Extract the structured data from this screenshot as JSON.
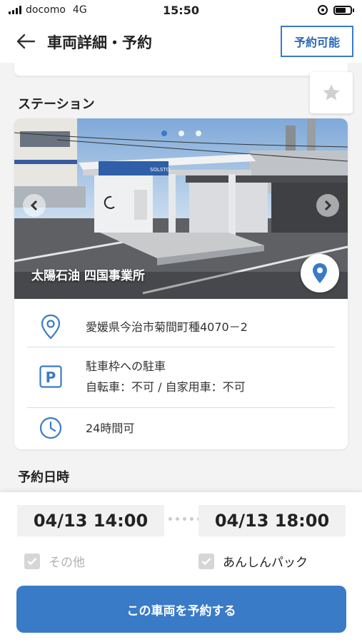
{
  "status_bar": {
    "carrier": "docomo",
    "network": "4G",
    "time": "15:50"
  },
  "header": {
    "title": "車両詳細・予約",
    "badge": "予約可能"
  },
  "station": {
    "section_title": "ステーション",
    "name": "太陽石油 四国事業所",
    "sign_text": "SOLSTO",
    "address": "愛媛県今治市菊間町種4070－2",
    "parking_line1": "駐車枠への駐車",
    "parking_line2": "自転車：不可 / 自家用車：不可",
    "hours": "24時間可",
    "carousel": {
      "total": 3,
      "active": 0
    }
  },
  "reservation": {
    "section_title": "予約日時",
    "start": "04/13 14:00",
    "end": "04/13 18:00",
    "options": [
      {
        "label": "その他",
        "checked": false
      },
      {
        "label": "あんしんパック",
        "checked": false
      }
    ],
    "reserve_button": "この車両を予約する"
  },
  "colors": {
    "accent": "#3a7bc8",
    "background": "#f3f3f3"
  },
  "icons": [
    "back-arrow-icon",
    "star-icon",
    "location-pin-icon",
    "parking-icon",
    "clock-icon",
    "chevron-left-icon",
    "chevron-right-icon",
    "map-pin-icon",
    "checkbox-icon"
  ]
}
